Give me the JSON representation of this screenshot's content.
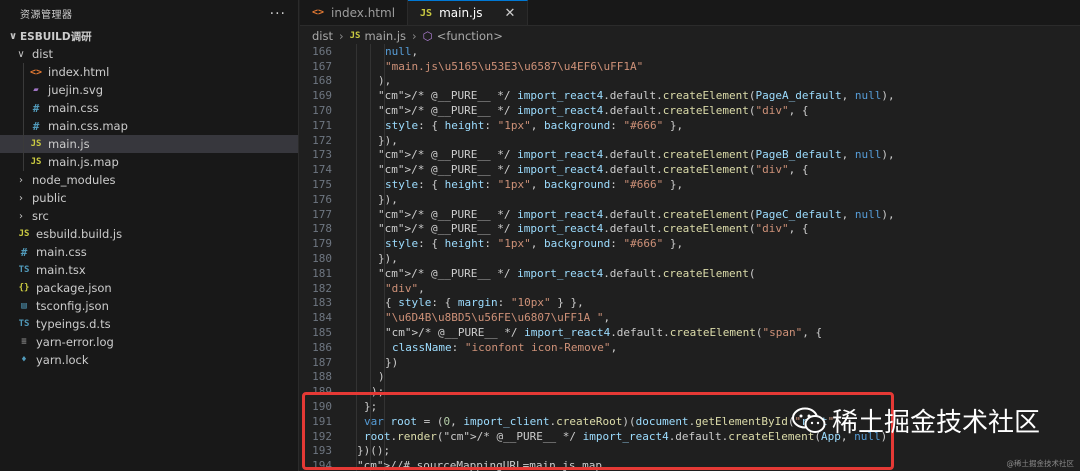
{
  "sidebar": {
    "title": "资源管理器",
    "more": "···",
    "root": "ESBUILD调研",
    "items": [
      {
        "label": "dist",
        "type": "folder-open"
      },
      {
        "label": "index.html",
        "icon": "<>",
        "iconClass": "html"
      },
      {
        "label": "juejin.svg",
        "icon": "▰",
        "iconClass": "svg"
      },
      {
        "label": "main.css",
        "icon": "#",
        "iconClass": "css"
      },
      {
        "label": "main.css.map",
        "icon": "#",
        "iconClass": "css"
      },
      {
        "label": "main.js",
        "icon": "JS",
        "iconClass": "js"
      },
      {
        "label": "main.js.map",
        "icon": "JS",
        "iconClass": "js"
      },
      {
        "label": "node_modules",
        "type": "folder"
      },
      {
        "label": "public",
        "type": "folder"
      },
      {
        "label": "src",
        "type": "folder"
      },
      {
        "label": "esbuild.build.js",
        "icon": "JS",
        "iconClass": "js"
      },
      {
        "label": "main.css",
        "icon": "#",
        "iconClass": "css"
      },
      {
        "label": "main.tsx",
        "icon": "TS",
        "iconClass": "ts"
      },
      {
        "label": "package.json",
        "icon": "{}",
        "iconClass": "json"
      },
      {
        "label": "tsconfig.json",
        "icon": "▤",
        "iconClass": "ts"
      },
      {
        "label": "typeings.d.ts",
        "icon": "TS",
        "iconClass": "ts"
      },
      {
        "label": "yarn-error.log",
        "icon": "≡",
        "iconClass": "log"
      },
      {
        "label": "yarn.lock",
        "icon": "♦",
        "iconClass": "lock"
      }
    ]
  },
  "tabs": [
    {
      "label": "index.html",
      "icon": "<>"
    },
    {
      "label": "main.js",
      "icon": "JS",
      "close": "✕"
    }
  ],
  "breadcrumb": {
    "folder": "dist",
    "file_icon": "JS",
    "file": "main.js",
    "symbol": "<function>"
  },
  "code": {
    "line_numbers": [
      "166",
      "167",
      "168",
      "169",
      "170",
      "171",
      "172",
      "173",
      "174",
      "175",
      "176",
      "177",
      "178",
      "179",
      "180",
      "181",
      "182",
      "183",
      "184",
      "185",
      "186",
      "187",
      "188",
      "189",
      "190",
      "191",
      "192",
      "193",
      "194"
    ],
    "lines": [
      "null,",
      "\"main.js\\u5165\\u53E3\\u6587\\u4EF6\\uFF1A\"",
      "),",
      "/* @__PURE__ */ import_react4.default.createElement(PageA_default, null),",
      "/* @__PURE__ */ import_react4.default.createElement(\"div\", {",
      "style: { height: \"1px\", background: \"#666\" },",
      "}),",
      "/* @__PURE__ */ import_react4.default.createElement(PageB_default, null),",
      "/* @__PURE__ */ import_react4.default.createElement(\"div\", {",
      "style: { height: \"1px\", background: \"#666\" },",
      "}),",
      "/* @__PURE__ */ import_react4.default.createElement(PageC_default, null),",
      "/* @__PURE__ */ import_react4.default.createElement(\"div\", {",
      "style: { height: \"1px\", background: \"#666\" },",
      "}),",
      "/* @__PURE__ */ import_react4.default.createElement(",
      "\"div\",",
      "{ style: { margin: \"10px\" } },",
      "\"\\u6D4B\\u8BD5\\u56FE\\u6807\\uFF1A \",",
      "/* @__PURE__ */ import_react4.default.createElement(\"span\", {",
      "className: \"iconfont icon-Remove\",",
      "})",
      ")",
      ");",
      "};",
      "var root = (0, import_client.createRoot)(document.getElementById(\"root\"",
      "root.render(/* @__PURE__ */ import_react4.default.createElement(App, null)",
      "})();",
      "//# sourceMappingURL=main.js.map"
    ]
  },
  "watermark": {
    "text": "稀土掘金技术社区",
    "small": "@稀土掘金技术社区"
  },
  "colors": {
    "highlight_box": "#e53935",
    "accent": "#0078d4"
  }
}
